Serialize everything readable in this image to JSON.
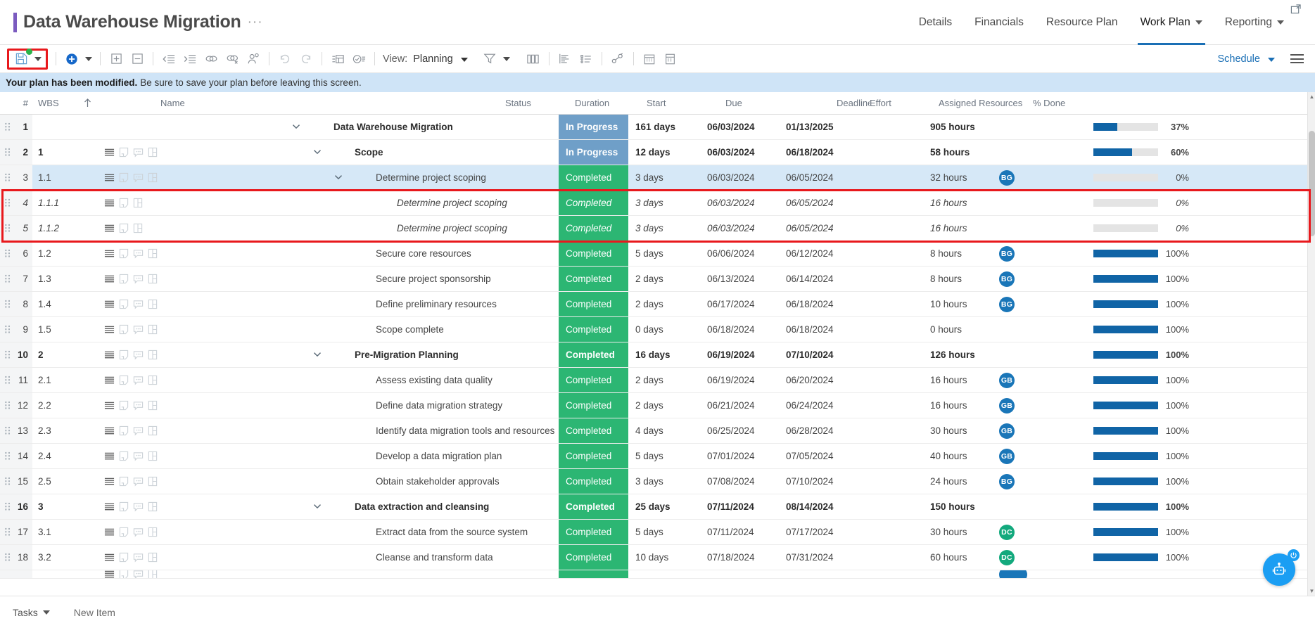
{
  "header": {
    "title": "Data Warehouse Migration",
    "title_menu": "···",
    "accent_color": "#7b5bbf",
    "nav": [
      {
        "label": "Details",
        "active": false,
        "has_caret": false
      },
      {
        "label": "Financials",
        "active": false,
        "has_caret": false
      },
      {
        "label": "Resource Plan",
        "active": false,
        "has_caret": false
      },
      {
        "label": "Work Plan",
        "active": true,
        "has_caret": true
      },
      {
        "label": "Reporting",
        "active": false,
        "has_caret": true
      }
    ],
    "popout_icon": "popout-icon"
  },
  "toolbar": {
    "save_icon": "save-icon",
    "save_dropdown_icon": "chevron-down-icon",
    "add_icon": "add-circle-icon",
    "add_dropdown_icon": "chevron-down-icon",
    "expand_all_icon": "expand-plus-icon",
    "collapse_all_icon": "collapse-minus-icon",
    "outdent_icon": "outdent-icon",
    "indent_icon": "indent-icon",
    "link_icon": "link-tasks-icon",
    "unlink_icon": "unlink-tasks-icon",
    "assign_resource_icon": "assign-resource-icon",
    "undo_icon": "undo-icon",
    "redo_icon": "redo-icon",
    "insert_row_icon": "insert-row-icon",
    "check_list_icon": "check-list-icon",
    "view_label": "View:",
    "view_value": "Planning",
    "filter_icon": "filter-icon",
    "filter_dropdown_icon": "chevron-down-icon",
    "columns_icon": "columns-icon",
    "gantt_icon": "gantt-icon",
    "outline_icon": "outline-icon",
    "baseline_icon": "baseline-icon",
    "calendar_icon": "calendar-icon",
    "report_icon": "report-icon",
    "schedule_label": "Schedule",
    "menu_icon": "hamburger-menu-icon"
  },
  "notice": {
    "strong": "Your plan has been modified.",
    "rest": "Be sure to save your plan before leaving this screen.",
    "background": "#cfe4f7"
  },
  "grid": {
    "columns": {
      "num": "#",
      "wbs": "WBS",
      "sort_icon": "sort-ascending-icon",
      "name": "Name",
      "status": "Status",
      "duration": "Duration",
      "start": "Start",
      "due": "Due",
      "deadline": "Deadline",
      "effort": "Effort",
      "assigned_resources": "Assigned Resources",
      "percent_done": "% Done"
    },
    "rows": [
      {
        "num": "1",
        "wbs": "",
        "name": "Data Warehouse Migration",
        "indent": 0,
        "bold": true,
        "italic": false,
        "expanded": true,
        "has_row_icons": false,
        "has_comment_icon": false,
        "status": "In Progress",
        "status_type": "inprogress",
        "duration": "161 days",
        "start": "06/03/2024",
        "due": "01/13/2025",
        "deadline": "",
        "effort": "905 hours",
        "resources": [],
        "pct": "37%",
        "pct_value": 37,
        "selected": false,
        "highlight": false
      },
      {
        "num": "2",
        "wbs": "1",
        "name": "Scope",
        "indent": 1,
        "bold": true,
        "italic": false,
        "expanded": true,
        "has_row_icons": true,
        "has_comment_icon": true,
        "status": "In Progress",
        "status_type": "inprogress",
        "duration": "12 days",
        "start": "06/03/2024",
        "due": "06/18/2024",
        "deadline": "",
        "effort": "58 hours",
        "resources": [],
        "pct": "60%",
        "pct_value": 60,
        "selected": false,
        "highlight": false
      },
      {
        "num": "3",
        "wbs": "1.1",
        "name": "Determine project scoping",
        "indent": 2,
        "bold": false,
        "italic": false,
        "expanded": true,
        "has_row_icons": true,
        "has_comment_icon": true,
        "status": "Completed",
        "status_type": "completed",
        "duration": "3 days",
        "start": "06/03/2024",
        "due": "06/05/2024",
        "deadline": "",
        "effort": "32 hours",
        "resources": [
          {
            "initials": "BG",
            "color": "blue"
          }
        ],
        "pct": "0%",
        "pct_value": 0,
        "selected": true,
        "highlight": false
      },
      {
        "num": "4",
        "wbs": "1.1.1",
        "name": "Determine project scoping",
        "indent": 3,
        "bold": false,
        "italic": true,
        "expanded": false,
        "has_row_icons": true,
        "has_comment_icon": false,
        "status": "Completed",
        "status_type": "completed",
        "duration": "3 days",
        "start": "06/03/2024",
        "due": "06/05/2024",
        "deadline": "",
        "effort": "16 hours",
        "resources": [],
        "pct": "0%",
        "pct_value": 0,
        "selected": false,
        "highlight": true
      },
      {
        "num": "5",
        "wbs": "1.1.2",
        "name": "Determine project scoping",
        "indent": 3,
        "bold": false,
        "italic": true,
        "expanded": false,
        "has_row_icons": true,
        "has_comment_icon": false,
        "status": "Completed",
        "status_type": "completed",
        "duration": "3 days",
        "start": "06/03/2024",
        "due": "06/05/2024",
        "deadline": "",
        "effort": "16 hours",
        "resources": [],
        "pct": "0%",
        "pct_value": 0,
        "selected": false,
        "highlight": true
      },
      {
        "num": "6",
        "wbs": "1.2",
        "name": "Secure core resources",
        "indent": 2,
        "bold": false,
        "italic": false,
        "expanded": false,
        "has_row_icons": true,
        "has_comment_icon": true,
        "status": "Completed",
        "status_type": "completed",
        "duration": "5 days",
        "start": "06/06/2024",
        "due": "06/12/2024",
        "deadline": "",
        "effort": "8 hours",
        "resources": [
          {
            "initials": "BG",
            "color": "blue"
          }
        ],
        "pct": "100%",
        "pct_value": 100,
        "selected": false,
        "highlight": false
      },
      {
        "num": "7",
        "wbs": "1.3",
        "name": "Secure project sponsorship",
        "indent": 2,
        "bold": false,
        "italic": false,
        "expanded": false,
        "has_row_icons": true,
        "has_comment_icon": true,
        "status": "Completed",
        "status_type": "completed",
        "duration": "2 days",
        "start": "06/13/2024",
        "due": "06/14/2024",
        "deadline": "",
        "effort": "8 hours",
        "resources": [
          {
            "initials": "BG",
            "color": "blue"
          }
        ],
        "pct": "100%",
        "pct_value": 100,
        "selected": false,
        "highlight": false
      },
      {
        "num": "8",
        "wbs": "1.4",
        "name": "Define preliminary resources",
        "indent": 2,
        "bold": false,
        "italic": false,
        "expanded": false,
        "has_row_icons": true,
        "has_comment_icon": true,
        "status": "Completed",
        "status_type": "completed",
        "duration": "2 days",
        "start": "06/17/2024",
        "due": "06/18/2024",
        "deadline": "",
        "effort": "10 hours",
        "resources": [
          {
            "initials": "BG",
            "color": "blue"
          }
        ],
        "pct": "100%",
        "pct_value": 100,
        "selected": false,
        "highlight": false
      },
      {
        "num": "9",
        "wbs": "1.5",
        "name": "Scope complete",
        "indent": 2,
        "bold": false,
        "italic": false,
        "expanded": false,
        "has_row_icons": true,
        "has_comment_icon": true,
        "status": "Completed",
        "status_type": "completed",
        "duration": "0 days",
        "start": "06/18/2024",
        "due": "06/18/2024",
        "deadline": "",
        "effort": "0 hours",
        "resources": [],
        "pct": "100%",
        "pct_value": 100,
        "selected": false,
        "highlight": false
      },
      {
        "num": "10",
        "wbs": "2",
        "name": "Pre-Migration Planning",
        "indent": 1,
        "bold": true,
        "italic": false,
        "expanded": true,
        "has_row_icons": true,
        "has_comment_icon": true,
        "status": "Completed",
        "status_type": "completed",
        "duration": "16 days",
        "start": "06/19/2024",
        "due": "07/10/2024",
        "deadline": "",
        "effort": "126 hours",
        "resources": [],
        "pct": "100%",
        "pct_value": 100,
        "selected": false,
        "highlight": false
      },
      {
        "num": "11",
        "wbs": "2.1",
        "name": "Assess existing data quality",
        "indent": 2,
        "bold": false,
        "italic": false,
        "expanded": false,
        "has_row_icons": true,
        "has_comment_icon": true,
        "status": "Completed",
        "status_type": "completed",
        "duration": "2 days",
        "start": "06/19/2024",
        "due": "06/20/2024",
        "deadline": "",
        "effort": "16 hours",
        "resources": [
          {
            "initials": "GB",
            "color": "blue"
          }
        ],
        "pct": "100%",
        "pct_value": 100,
        "selected": false,
        "highlight": false
      },
      {
        "num": "12",
        "wbs": "2.2",
        "name": "Define data migration strategy",
        "indent": 2,
        "bold": false,
        "italic": false,
        "expanded": false,
        "has_row_icons": true,
        "has_comment_icon": true,
        "status": "Completed",
        "status_type": "completed",
        "duration": "2 days",
        "start": "06/21/2024",
        "due": "06/24/2024",
        "deadline": "",
        "effort": "16 hours",
        "resources": [
          {
            "initials": "GB",
            "color": "blue"
          }
        ],
        "pct": "100%",
        "pct_value": 100,
        "selected": false,
        "highlight": false
      },
      {
        "num": "13",
        "wbs": "2.3",
        "name": "Identify data migration tools and resources",
        "indent": 2,
        "bold": false,
        "italic": false,
        "expanded": false,
        "has_row_icons": true,
        "has_comment_icon": true,
        "status": "Completed",
        "status_type": "completed",
        "duration": "4 days",
        "start": "06/25/2024",
        "due": "06/28/2024",
        "deadline": "",
        "effort": "30 hours",
        "resources": [
          {
            "initials": "GB",
            "color": "blue"
          }
        ],
        "pct": "100%",
        "pct_value": 100,
        "selected": false,
        "highlight": false
      },
      {
        "num": "14",
        "wbs": "2.4",
        "name": "Develop a data migration plan",
        "indent": 2,
        "bold": false,
        "italic": false,
        "expanded": false,
        "has_row_icons": true,
        "has_comment_icon": true,
        "status": "Completed",
        "status_type": "completed",
        "duration": "5 days",
        "start": "07/01/2024",
        "due": "07/05/2024",
        "deadline": "",
        "effort": "40 hours",
        "resources": [
          {
            "initials": "GB",
            "color": "blue"
          }
        ],
        "pct": "100%",
        "pct_value": 100,
        "selected": false,
        "highlight": false
      },
      {
        "num": "15",
        "wbs": "2.5",
        "name": "Obtain stakeholder approvals",
        "indent": 2,
        "bold": false,
        "italic": false,
        "expanded": false,
        "has_row_icons": true,
        "has_comment_icon": true,
        "status": "Completed",
        "status_type": "completed",
        "duration": "3 days",
        "start": "07/08/2024",
        "due": "07/10/2024",
        "deadline": "",
        "effort": "24 hours",
        "resources": [
          {
            "initials": "BG",
            "color": "blue"
          }
        ],
        "pct": "100%",
        "pct_value": 100,
        "selected": false,
        "highlight": false
      },
      {
        "num": "16",
        "wbs": "3",
        "name": "Data extraction and cleansing",
        "indent": 1,
        "bold": true,
        "italic": false,
        "expanded": true,
        "has_row_icons": true,
        "has_comment_icon": true,
        "status": "Completed",
        "status_type": "completed",
        "duration": "25 days",
        "start": "07/11/2024",
        "due": "08/14/2024",
        "deadline": "",
        "effort": "150 hours",
        "resources": [],
        "pct": "100%",
        "pct_value": 100,
        "selected": false,
        "highlight": false
      },
      {
        "num": "17",
        "wbs": "3.1",
        "name": "Extract data from the source system",
        "indent": 2,
        "bold": false,
        "italic": false,
        "expanded": false,
        "has_row_icons": true,
        "has_comment_icon": true,
        "status": "Completed",
        "status_type": "completed",
        "duration": "5 days",
        "start": "07/11/2024",
        "due": "07/17/2024",
        "deadline": "",
        "effort": "30 hours",
        "resources": [
          {
            "initials": "DC",
            "color": "green"
          }
        ],
        "pct": "100%",
        "pct_value": 100,
        "selected": false,
        "highlight": false
      },
      {
        "num": "18",
        "wbs": "3.2",
        "name": "Cleanse and transform data",
        "indent": 2,
        "bold": false,
        "italic": false,
        "expanded": false,
        "has_row_icons": true,
        "has_comment_icon": true,
        "status": "Completed",
        "status_type": "completed",
        "duration": "10 days",
        "start": "07/18/2024",
        "due": "07/31/2024",
        "deadline": "",
        "effort": "60 hours",
        "resources": [
          {
            "initials": "DC",
            "color": "green"
          }
        ],
        "pct": "100%",
        "pct_value": 100,
        "selected": false,
        "highlight": false
      }
    ],
    "selection_color": "#e8181c",
    "status_colors": {
      "in_progress": "#6f9fc8",
      "completed": "#2cb673"
    },
    "progress_color": "#1064a6"
  },
  "footer": {
    "tasks_label": "Tasks",
    "new_item_label": "New Item",
    "assistant_icon": "assistant-robot-icon",
    "power_icon": "power-icon"
  }
}
